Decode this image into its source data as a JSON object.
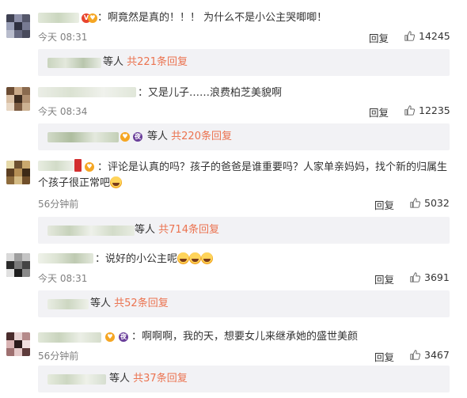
{
  "colors": {
    "link_orange": "#eb7350",
    "meta_gray": "#808080",
    "sub_bg": "#f2f2f5"
  },
  "comments": [
    {
      "text": "：啊竟然是真的！！！  为什么不是小公主哭唧唧！",
      "time": "今天 08:31",
      "reply_label": "回复",
      "likes": "14245",
      "sub": {
        "prefix": "等人",
        "count_text": "共221条回复"
      }
    },
    {
      "text": "：又是儿子……浪费柏芝美貌啊",
      "time": "今天 08:34",
      "reply_label": "回复",
      "likes": "12235",
      "sub": {
        "prefix": "等人",
        "count_text": "共220条回复"
      }
    },
    {
      "text": "：评论是认真的吗？孩子的爸爸是谁重要吗？人家单亲妈妈，找个新的归属生个孩子很正常吧",
      "time": "56分钟前",
      "reply_label": "回复",
      "likes": "5032",
      "sub": {
        "prefix": "等人",
        "count_text": "共714条回复"
      }
    },
    {
      "text": "：说好的小公主呢",
      "time": "今天 08:31",
      "reply_label": "回复",
      "likes": "3691",
      "sub": {
        "prefix": "等人",
        "count_text": "共52条回复"
      }
    },
    {
      "text": "：啊啊啊，我的天，想要女儿来继承她的盛世美颜",
      "time": "56分钟前",
      "reply_label": "回复",
      "likes": "3467",
      "sub": {
        "prefix": "等人",
        "count_text": "共37条回复"
      }
    }
  ],
  "icons": {
    "like": "thumbs-up-icon",
    "emoji": "crying-laugh-emoji-icon",
    "vip": "vip-badge-icon"
  }
}
